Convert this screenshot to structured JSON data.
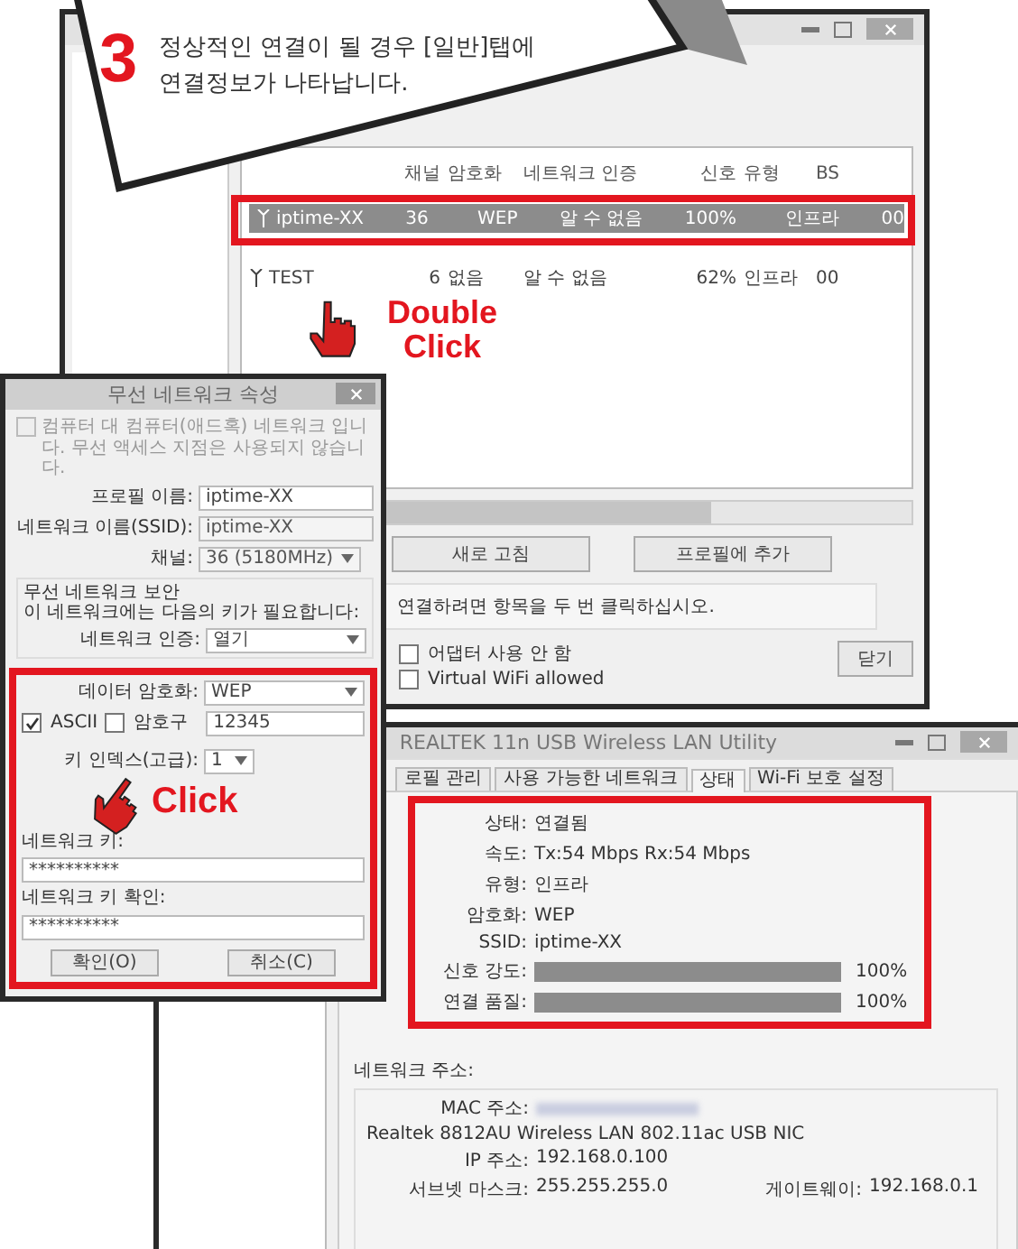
{
  "callout": {
    "step": "3",
    "lines": [
      "정상적인 연결이 될 경우 [일반]탭에",
      "연결정보가 나타납니다."
    ]
  },
  "network_window": {
    "columns": [
      "채널",
      "암호화",
      "네트워크 인증",
      "신호",
      "유형",
      "BS"
    ],
    "rows": [
      {
        "name": "iptime-XX",
        "channel": "36",
        "encryption": "WEP",
        "auth": "알 수 없음",
        "signal": "100%",
        "type": "인프라",
        "bssid": "00",
        "selected": true
      },
      {
        "name": "TEST",
        "channel": "6",
        "encryption": "없음",
        "auth": "알 수 없음",
        "signal": "62%",
        "type": "인프라",
        "bssid": "00",
        "selected": false
      }
    ],
    "buttons": [
      "새로 고침",
      "프로필에 추가"
    ],
    "hint": "연결하려면 항목을 두 번 클릭하십시오.",
    "options": [
      {
        "label": "어댑터 사용 안 함",
        "checked": false
      },
      {
        "label": "Virtual WiFi allowed",
        "checked": false
      }
    ],
    "close_button": "닫기"
  },
  "properties_dialog": {
    "title": "무선 네트워크 속성",
    "adhoc": {
      "label": "컴퓨터 대 컴퓨터(애드혹) 네트워크 입니다. 무선 액세스 지점은 사용되지 않습니다.",
      "checked": false,
      "disabled": true
    },
    "profile_name": {
      "label": "프로필 이름:",
      "value": "iptime-XX"
    },
    "ssid": {
      "label": "네트워크 이름(SSID):",
      "value": "iptime-XX"
    },
    "channel": {
      "label": "채널:",
      "value": "36 (5180MHz)"
    },
    "security_title": "무선 네트워크 보안",
    "security_note": "이 네트워크에는 다음의 키가 필요합니다:",
    "auth": {
      "label": "네트워크 인증:",
      "value": "열기"
    },
    "encryption": {
      "label": "데이터 암호화:",
      "value": "WEP"
    },
    "key_options": [
      {
        "label": "ASCII",
        "checked": true
      },
      {
        "label": "암호구",
        "checked": false
      }
    ],
    "key_input": "12345",
    "key_index": {
      "label": "키 인덱스(고급):",
      "value": "1"
    },
    "network_key": {
      "label": "네트워크 키:",
      "value": "**********"
    },
    "confirm_key": {
      "label": "네트워크 키 확인:",
      "value": "**********"
    },
    "buttons": [
      "확인(O)",
      "취소(C)"
    ]
  },
  "utility_window": {
    "title": "REALTEK 11n USB Wireless LAN Utility",
    "tabs": [
      {
        "label": "로필 관리",
        "selected": false
      },
      {
        "label": "사용 가능한 네트워크",
        "selected": false
      },
      {
        "label": "상태",
        "selected": true
      },
      {
        "label": "Wi-Fi 보호 설정",
        "selected": false
      }
    ],
    "status": [
      {
        "label": "상태:",
        "value": "연결됨"
      },
      {
        "label": "속도:",
        "value": "Tx:54 Mbps Rx:54 Mbps"
      },
      {
        "label": "유형:",
        "value": "인프라"
      },
      {
        "label": "암호화:",
        "value": "WEP"
      },
      {
        "label": "SSID:",
        "value": "iptime-XX"
      }
    ],
    "meters": [
      {
        "label": "신호 강도:",
        "level": 1,
        "reading": "100%"
      },
      {
        "label": "연결 품질:",
        "level": 1,
        "reading": "100%"
      }
    ],
    "address_title": "네트워크 주소:",
    "mac_label": "MAC 주소:",
    "adapter": "Realtek 8812AU Wireless LAN 802.11ac USB NIC",
    "ip": {
      "label": "IP 주소:",
      "value": "192.168.0.100"
    },
    "subnet": {
      "label": "서브넷 마스크:",
      "value": "255.255.255.0"
    },
    "gateway": {
      "label": "게이트웨이:",
      "value": "192.168.0.1"
    }
  },
  "annotations": [
    {
      "kind": "double",
      "text": "Double Click"
    },
    {
      "kind": "single",
      "text": "Click"
    }
  ]
}
